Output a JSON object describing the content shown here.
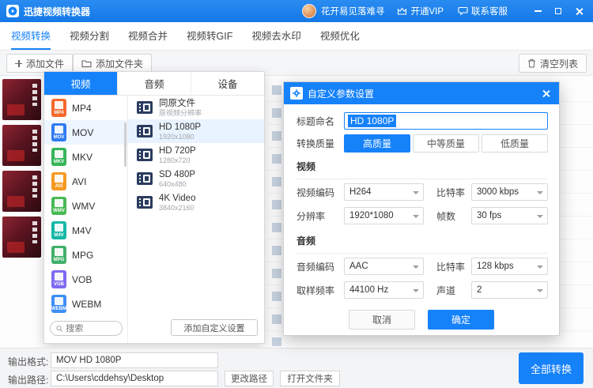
{
  "colors": {
    "accent": "#1682fa"
  },
  "titlebar": {
    "app_name": "迅捷视频转换器",
    "username": "花开易见落难寻",
    "vip_label": "开通VIP",
    "support_label": "联系客服"
  },
  "tabs": [
    {
      "label": "视频转换"
    },
    {
      "label": "视频分割"
    },
    {
      "label": "视频合并"
    },
    {
      "label": "视频转GIF"
    },
    {
      "label": "视频去水印"
    },
    {
      "label": "视频优化"
    }
  ],
  "toolbar": {
    "add_file": "添加文件",
    "add_folder": "添加文件夹",
    "clear_list": "清空列表"
  },
  "format_panel": {
    "tabs": [
      {
        "label": "视频"
      },
      {
        "label": "音频"
      },
      {
        "label": "设备"
      }
    ],
    "formats": [
      {
        "name": "MP4",
        "color": "#f4692c"
      },
      {
        "name": "MOV",
        "color": "#2f7bf3"
      },
      {
        "name": "MKV",
        "color": "#35b558"
      },
      {
        "name": "AVI",
        "color": "#f59a23"
      },
      {
        "name": "WMV",
        "color": "#49b954"
      },
      {
        "name": "M4V",
        "color": "#16b8a6"
      },
      {
        "name": "MPG",
        "color": "#41b06a"
      },
      {
        "name": "VOB",
        "color": "#7d6bf0"
      },
      {
        "name": "WEBM",
        "color": "#3e8ef7"
      }
    ],
    "search_placeholder": "搜索",
    "resolutions": [
      {
        "name": "同原文件",
        "detail": "原视频分辨率"
      },
      {
        "name": "HD 1080P",
        "detail": "1920x1080"
      },
      {
        "name": "HD 720P",
        "detail": "1280x720"
      },
      {
        "name": "SD 480P",
        "detail": "640x480"
      },
      {
        "name": "4K Video",
        "detail": "3840x2160"
      }
    ],
    "add_custom_label": "添加自定义设置"
  },
  "dialog": {
    "title": "自定义参数设置",
    "name_label": "标题命名",
    "name_value": "HD 1080P",
    "quality_label": "转换质量",
    "quality_options": [
      {
        "label": "高质量"
      },
      {
        "label": "中等质量"
      },
      {
        "label": "低质量"
      }
    ],
    "video_section": "视频",
    "video_codec_label": "视频编码",
    "video_codec_value": "H264",
    "video_bitrate_label": "比特率",
    "video_bitrate_value": "3000 kbps",
    "resolution_label": "分辨率",
    "resolution_value": "1920*1080",
    "framerate_label": "帧数",
    "framerate_value": "30 fps",
    "audio_section": "音频",
    "audio_codec_label": "音频编码",
    "audio_codec_value": "AAC",
    "audio_bitrate_label": "比特率",
    "audio_bitrate_value": "128 kbps",
    "sample_rate_label": "取样频率",
    "sample_rate_value": "44100 Hz",
    "channel_label": "声道",
    "channel_value": "2",
    "cancel_label": "取消",
    "confirm_label": "确定"
  },
  "footer": {
    "output_format_label": "输出格式:",
    "output_format_value": "MOV  HD 1080P",
    "output_path_label": "输出路径:",
    "output_path_value": "C:\\Users\\cddehsy\\Desktop",
    "change_path_label": "更改路径",
    "open_folder_label": "打开文件夹",
    "convert_all_label": "全部转换"
  }
}
